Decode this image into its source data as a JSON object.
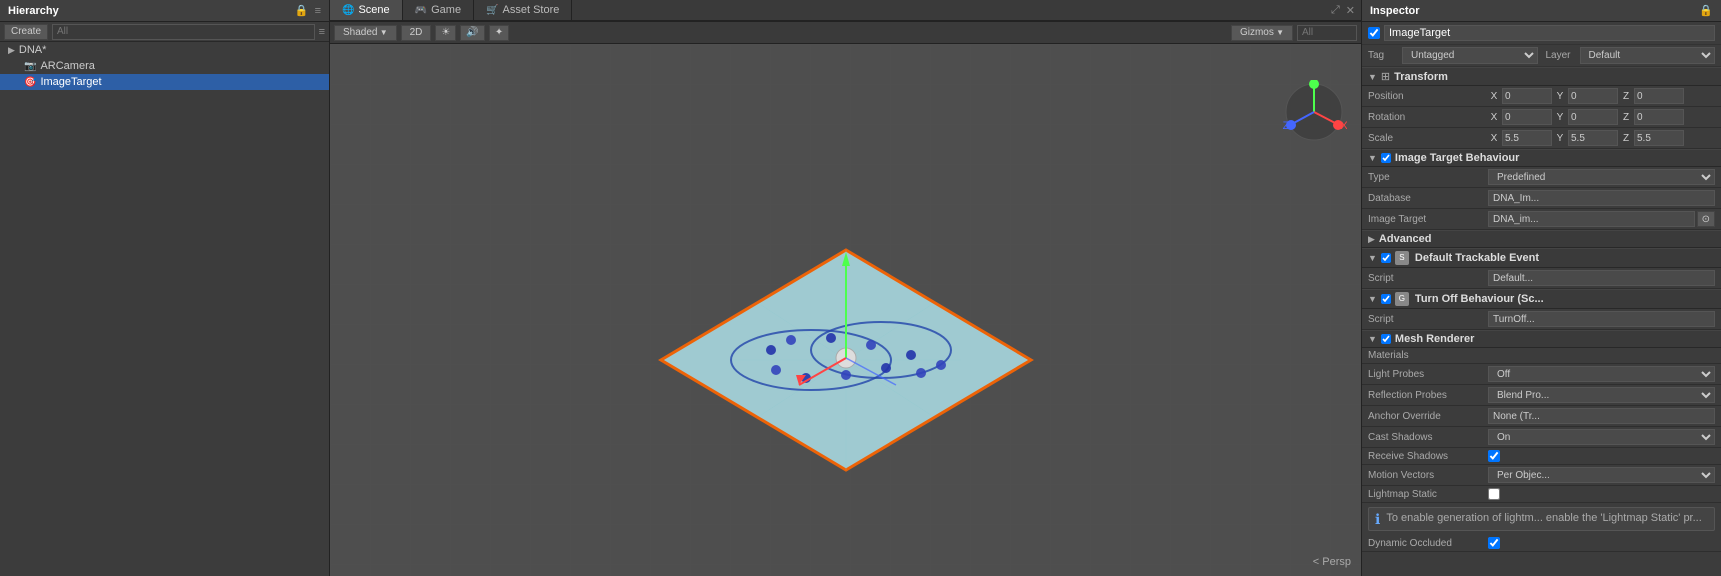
{
  "tabs": {
    "hierarchy": "Hierarchy",
    "scene": "Scene",
    "game": "Game",
    "asset_store": "Asset Store"
  },
  "hierarchy": {
    "create_button": "Create",
    "search_placeholder": "All",
    "items": [
      {
        "id": "dna",
        "label": "DNA*",
        "indent": 0,
        "icon": "▶",
        "selected": false
      },
      {
        "id": "arcamera",
        "label": "ARCamera",
        "indent": 1,
        "icon": "📷",
        "selected": false
      },
      {
        "id": "imagetarget",
        "label": "ImageTarget",
        "indent": 1,
        "icon": "🎯",
        "selected": true
      }
    ]
  },
  "scene_toolbar": {
    "shading": "Shaded",
    "mode_2d": "2D",
    "gizmos_label": "Gizmos",
    "search_all": "All"
  },
  "persp_label": "< Persp",
  "inspector": {
    "title": "Inspector",
    "object_name": "ImageTarget",
    "tag_label": "Tag",
    "tag_value": "Untagged",
    "layer_label": "Layer",
    "layer_value": "Default",
    "sections": {
      "transform": {
        "label": "Transform",
        "position_label": "Position",
        "position": {
          "x": "0",
          "y": "0",
          "z": "0"
        },
        "rotation_label": "Rotation",
        "rotation": {
          "x": "0",
          "y": "0",
          "z": "0"
        },
        "scale_label": "Scale",
        "scale": {
          "x": "5.5",
          "y": "5.5",
          "z": "5.5"
        }
      },
      "image_target_behaviour": {
        "label": "Image Target Behaviour",
        "type_label": "Type",
        "type_value": "Predefined",
        "database_label": "Database",
        "database_value": "DNA_Im...",
        "image_target_label": "Image Target",
        "image_target_value": "DNA_im..."
      },
      "advanced": {
        "label": "Advanced"
      },
      "default_trackable_event": {
        "label": "Default Trackable Event",
        "script_label": "Script",
        "script_value": "Default..."
      },
      "turn_off_behaviour": {
        "label": "Turn Off Behaviour (Sc...",
        "script_label": "Script",
        "script_value": "TurnOff..."
      },
      "mesh_renderer": {
        "label": "Mesh Renderer",
        "materials_label": "Materials",
        "light_probes_label": "Light Probes",
        "light_probes_value": "Off",
        "reflection_probes_label": "Reflection Probes",
        "reflection_probes_value": "Blend Pro...",
        "anchor_override_label": "Anchor Override",
        "anchor_override_value": "None (Tr...",
        "cast_shadows_label": "Cast Shadows",
        "cast_shadows_value": "On",
        "receive_shadows_label": "Receive Shadows",
        "receive_shadows_checked": true,
        "motion_vectors_label": "Motion Vectors",
        "motion_vectors_value": "Per Objec...",
        "lightmap_static_label": "Lightmap Static",
        "lightmap_static_checked": false,
        "info_text": "To enable generation of lightm... enable the 'Lightmap Static' pr...",
        "dynamic_occluded_label": "Dynamic Occluded",
        "dynamic_occluded_checked": true
      }
    }
  },
  "icons": {
    "expand_arrow": "▶",
    "collapse_arrow": "▼",
    "lock": "🔒",
    "checkbox_checked": "✓",
    "info": "ℹ"
  },
  "colors": {
    "accent_blue": "#2d5fa6",
    "accent_orange": "#ff6600",
    "panel_bg": "#3c3c3c",
    "section_bg": "#3a3a3a",
    "input_bg": "#4a4a4a",
    "border": "#282828"
  }
}
